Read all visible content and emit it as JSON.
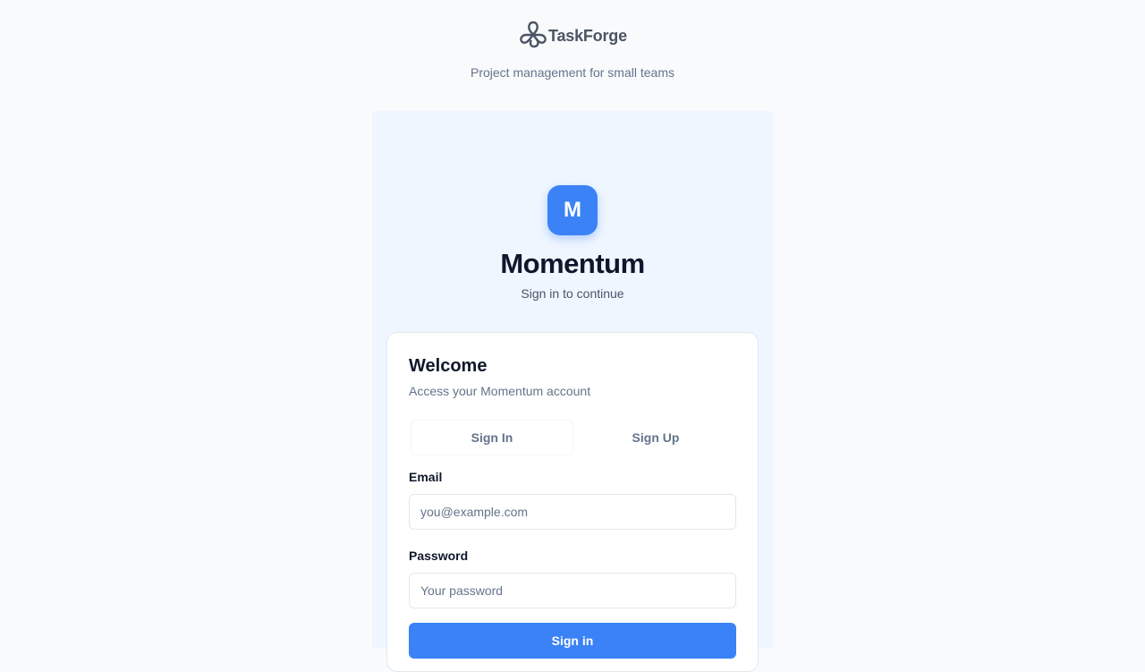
{
  "brand": {
    "name": "TaskForge",
    "tagline": "Project management for small teams",
    "logo_icon": "knot-logo-icon"
  },
  "app": {
    "avatar_letter": "M",
    "title": "Momentum",
    "subtitle": "Sign in to continue"
  },
  "card": {
    "title": "Welcome",
    "subtitle": "Access your Momentum account",
    "tabs": [
      {
        "label": "Sign In",
        "active": true
      },
      {
        "label": "Sign Up",
        "active": false
      }
    ],
    "email": {
      "label": "Email",
      "placeholder": "you@example.com",
      "value": ""
    },
    "password": {
      "label": "Password",
      "placeholder": "Your password",
      "value": ""
    },
    "submit_label": "Sign in"
  },
  "colors": {
    "accent": "#3b82f6",
    "panel_bg": "#eff6ff",
    "page_bg": "#f8fafc"
  }
}
